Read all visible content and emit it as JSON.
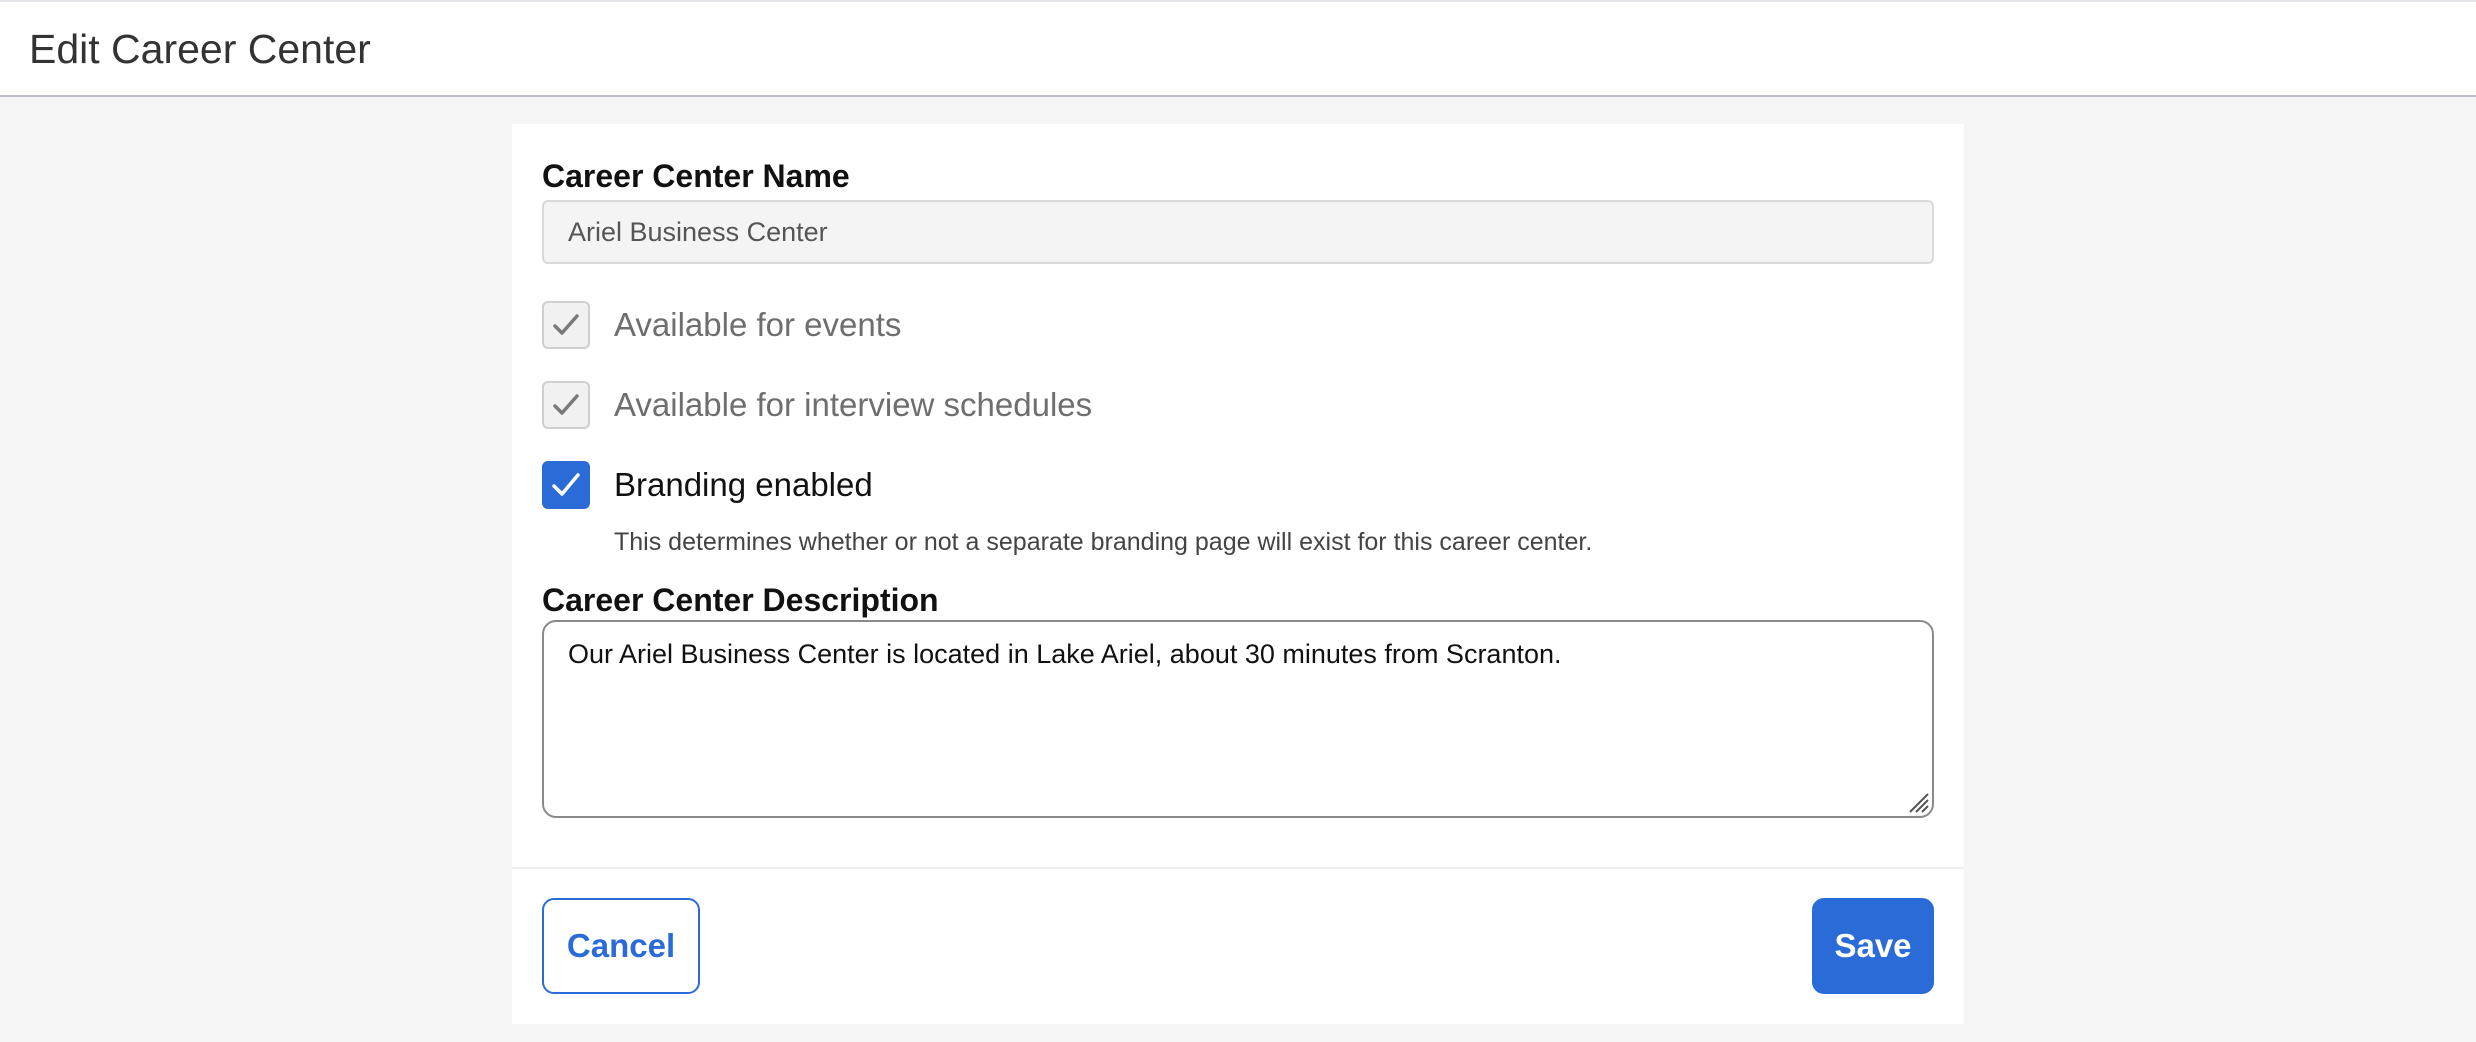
{
  "header": {
    "title": "Edit Career Center"
  },
  "form": {
    "name_label": "Career Center Name",
    "name_value": "Ariel Business Center",
    "checkboxes": [
      {
        "label": "Available for events",
        "checked": true,
        "disabled": true
      },
      {
        "label": "Available for interview schedules",
        "checked": true,
        "disabled": true
      },
      {
        "label": "Branding enabled",
        "checked": true,
        "disabled": false
      }
    ],
    "branding_help": "This determines whether or not a separate branding page will exist for this career center.",
    "description_label": "Career Center Description",
    "description_value": "Our Ariel Business Center is located in Lake Ariel, about 30 minutes from Scranton."
  },
  "actions": {
    "cancel_label": "Cancel",
    "save_label": "Save"
  },
  "colors": {
    "accent": "#2b6bd8",
    "page_background": "#f5f5f5",
    "card_background": "#ffffff",
    "disabled_check": "#7a7a7a"
  },
  "icons": {
    "checkbox_mark": "checkmark-icon",
    "textarea_resize": "resize-grip-icon"
  }
}
